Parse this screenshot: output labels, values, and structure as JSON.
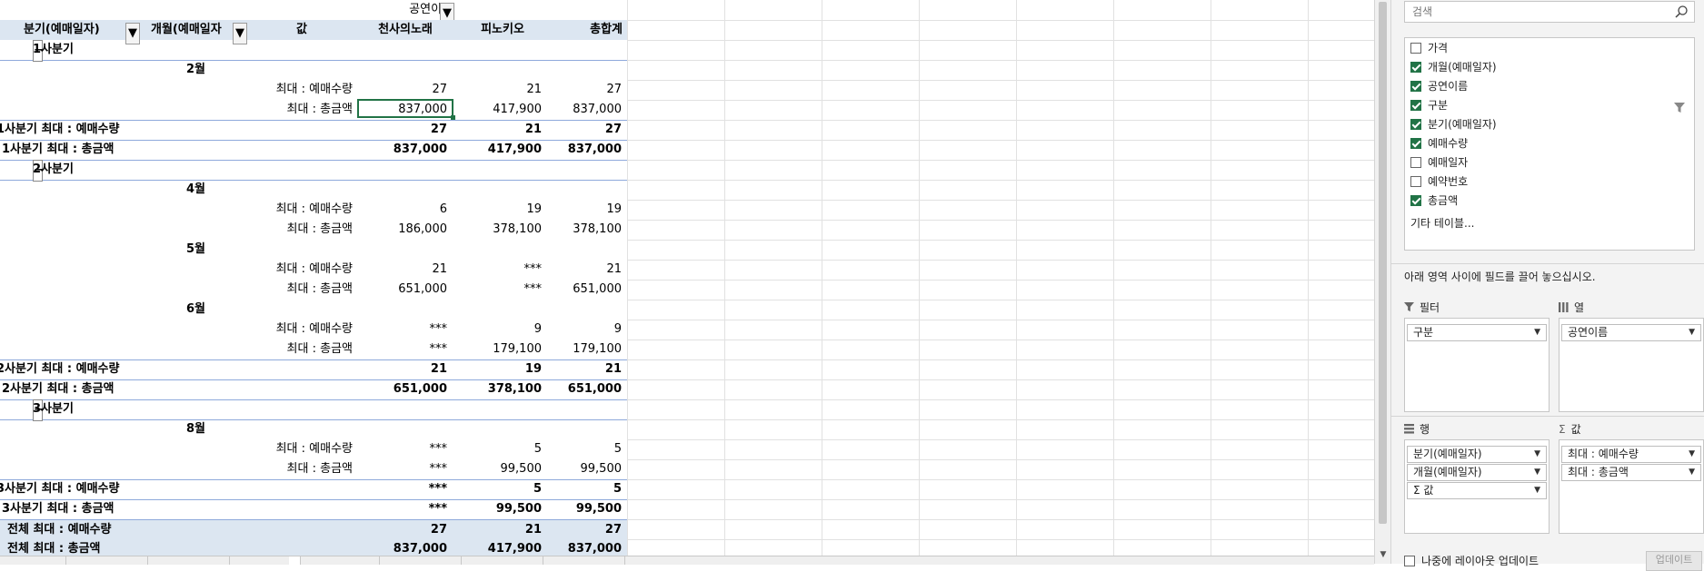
{
  "pivot": {
    "column_field_label": "공연이름",
    "header": {
      "quarter_label": "분기(예매일자)",
      "month_label": "개월(예매일자",
      "value_label": "값",
      "col1": "천사의노래",
      "col2": "피노키오",
      "col3": "총합계"
    },
    "rows": [
      {
        "kind": "quarter",
        "label": "1사분기"
      },
      {
        "kind": "month",
        "label": "2월"
      },
      {
        "kind": "value",
        "label": "최대 : 예매수량",
        "v1": "27",
        "v2": "21",
        "v3": "27"
      },
      {
        "kind": "value",
        "label": "최대 : 총금액",
        "v1": "837,000",
        "v2": "417,900",
        "v3": "837,000"
      },
      {
        "kind": "subtotal",
        "label": "1사분기 최대 : 예매수량",
        "v1": "27",
        "v2": "21",
        "v3": "27"
      },
      {
        "kind": "subtotal",
        "label": "1사분기 최대 : 총금액",
        "v1": "837,000",
        "v2": "417,900",
        "v3": "837,000"
      },
      {
        "kind": "quarter",
        "label": "2사분기"
      },
      {
        "kind": "month",
        "label": "4월"
      },
      {
        "kind": "value",
        "label": "최대 : 예매수량",
        "v1": "6",
        "v2": "19",
        "v3": "19"
      },
      {
        "kind": "value",
        "label": "최대 : 총금액",
        "v1": "186,000",
        "v2": "378,100",
        "v3": "378,100"
      },
      {
        "kind": "month",
        "label": "5월"
      },
      {
        "kind": "value",
        "label": "최대 : 예매수량",
        "v1": "21",
        "v2": "***",
        "v3": "21"
      },
      {
        "kind": "value",
        "label": "최대 : 총금액",
        "v1": "651,000",
        "v2": "***",
        "v3": "651,000"
      },
      {
        "kind": "month",
        "label": "6월"
      },
      {
        "kind": "value",
        "label": "최대 : 예매수량",
        "v1": "***",
        "v2": "9",
        "v3": "9"
      },
      {
        "kind": "value",
        "label": "최대 : 총금액",
        "v1": "***",
        "v2": "179,100",
        "v3": "179,100"
      },
      {
        "kind": "subtotal",
        "label": "2사분기 최대 : 예매수량",
        "v1": "21",
        "v2": "19",
        "v3": "21"
      },
      {
        "kind": "subtotal",
        "label": "2사분기 최대 : 총금액",
        "v1": "651,000",
        "v2": "378,100",
        "v3": "651,000"
      },
      {
        "kind": "quarter",
        "label": "3사분기"
      },
      {
        "kind": "month",
        "label": "8월"
      },
      {
        "kind": "value",
        "label": "최대 : 예매수량",
        "v1": "***",
        "v2": "5",
        "v3": "5"
      },
      {
        "kind": "value",
        "label": "최대 : 총금액",
        "v1": "***",
        "v2": "99,500",
        "v3": "99,500"
      },
      {
        "kind": "subtotal",
        "label": "3사분기 최대 : 예매수량",
        "v1": "***",
        "v2": "5",
        "v3": "5"
      },
      {
        "kind": "subtotal",
        "label": "3사분기 최대 : 총금액",
        "v1": "***",
        "v2": "99,500",
        "v3": "99,500"
      },
      {
        "kind": "grand",
        "label": "전체 최대 : 예매수량",
        "v1": "27",
        "v2": "21",
        "v3": "27"
      },
      {
        "kind": "grand",
        "label": "전체 최대 : 총금액",
        "v1": "837,000",
        "v2": "417,900",
        "v3": "837,000"
      }
    ]
  },
  "field_pane": {
    "search_placeholder": "검색",
    "fields": [
      {
        "label": "가격",
        "checked": false
      },
      {
        "label": "개월(예매일자)",
        "checked": true
      },
      {
        "label": "공연이름",
        "checked": true
      },
      {
        "label": "구분",
        "checked": true
      },
      {
        "label": "분기(예매일자)",
        "checked": true
      },
      {
        "label": "예매수량",
        "checked": true
      },
      {
        "label": "예매일자",
        "checked": false
      },
      {
        "label": "예약번호",
        "checked": false
      },
      {
        "label": "총금액",
        "checked": true
      }
    ],
    "more_tables": "기타 테이블...",
    "drop_message": "아래 영역 사이에 필드를 끌어 놓으십시오.",
    "areas": {
      "filter_label": "필터",
      "columns_label": "열",
      "rows_label": "행",
      "values_label": "값",
      "filter_items": [
        "구분"
      ],
      "column_items": [
        "공연이름"
      ],
      "row_items": [
        "분기(예매일자)",
        "개월(예매일자)",
        "Σ 값"
      ],
      "value_items": [
        "최대 : 예매수량",
        "최대 : 총금액"
      ]
    },
    "defer_label": "나중에 레이아웃 업데이트",
    "update_button": "업데이트"
  }
}
